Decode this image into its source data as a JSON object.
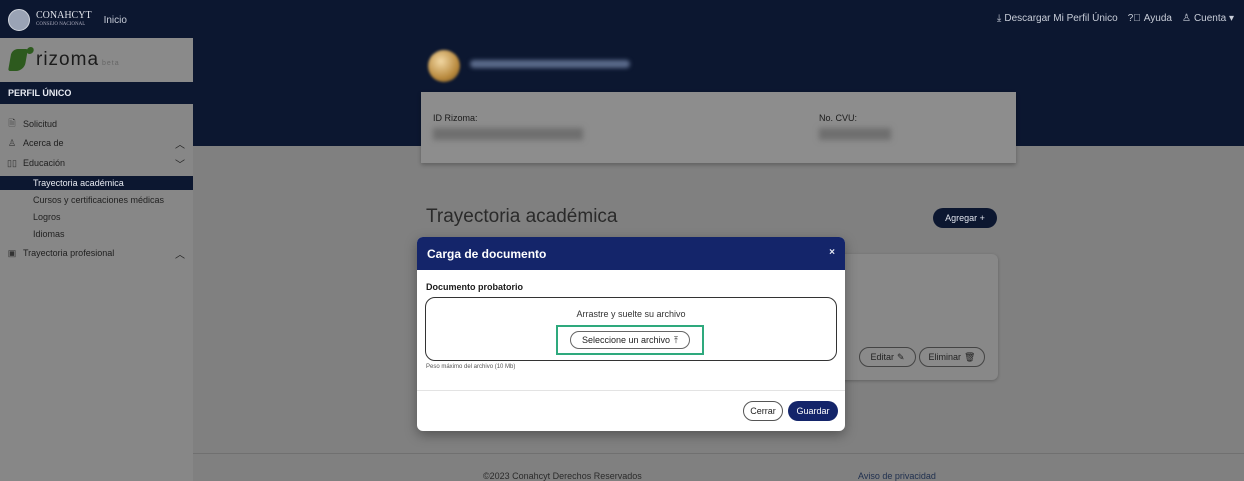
{
  "topbar": {
    "brand": "CONAHCYT",
    "brand_sub": "CONSEJO NACIONAL",
    "inicio": "Inicio",
    "download": "Descargar Mi Perfil Único",
    "help": "Ayuda",
    "account": "Cuenta"
  },
  "sidebar": {
    "logo": "rizoma",
    "logo_sub": "beta",
    "section": "PERFIL ÚNICO",
    "items": [
      {
        "label": "Solicitud",
        "icon": "document-icon"
      },
      {
        "label": "Acerca de",
        "icon": "person-icon",
        "chevron": "^"
      },
      {
        "label": "Educación",
        "icon": "book-icon",
        "chevron": "v"
      },
      {
        "label": "Trayectoria profesional",
        "icon": "briefcase-icon",
        "chevron": "^"
      }
    ],
    "subitems": [
      "Trayectoria académica",
      "Cursos y certificaciones médicas",
      "Logros",
      "Idiomas"
    ]
  },
  "profile": {
    "id_label": "ID Rizoma:",
    "cvu_label": "No. CVU:"
  },
  "main": {
    "title": "Trayectoria académica",
    "add_button": "Agregar +",
    "edit_button": "Editar",
    "delete_button": "Eliminar"
  },
  "modal": {
    "title": "Carga de documento",
    "close": "×",
    "doc_label": "Documento probatorio",
    "drop_text": "Arrastre y suelte su archivo",
    "select_button": "Seleccione un archivo",
    "max_size": "Peso máximo del archivo (10 Mb)",
    "cancel": "Cerrar",
    "save": "Guardar"
  },
  "footer": {
    "copyright": "©2023 Conahcyt Derechos Reservados",
    "privacy": "Aviso de privacidad"
  }
}
